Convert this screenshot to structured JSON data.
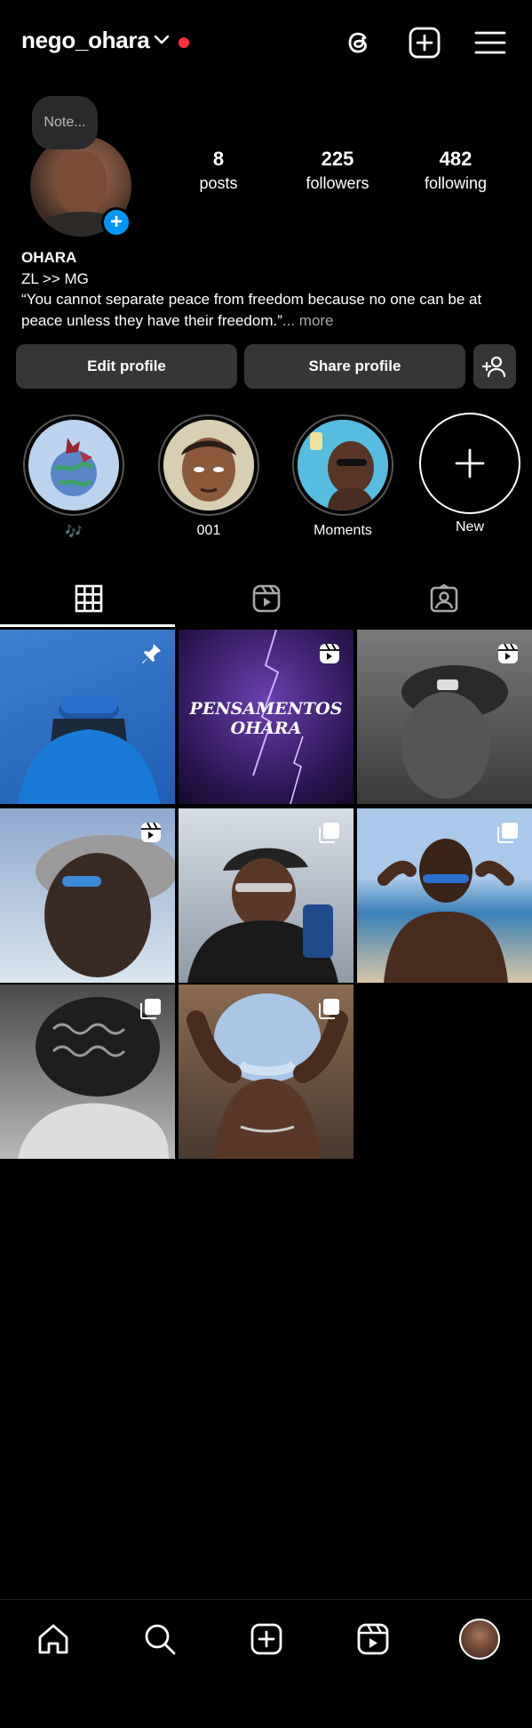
{
  "header": {
    "username": "nego_ohara"
  },
  "profile": {
    "note_placeholder": "Note...",
    "stats": [
      {
        "value": "8",
        "label": "posts"
      },
      {
        "value": "225",
        "label": "followers"
      },
      {
        "value": "482",
        "label": "following"
      }
    ],
    "bio": {
      "name": "OHARA",
      "line1": "ZL >> MG",
      "quote": "“You cannot separate peace from freedom because no one can be at peace unless they have their freedom.”",
      "more": "... more"
    }
  },
  "buttons": {
    "edit": "Edit profile",
    "share": "Share profile"
  },
  "highlights": [
    {
      "label": "🎶"
    },
    {
      "label": "001"
    },
    {
      "label": "Moments"
    },
    {
      "label": "New"
    }
  ],
  "grid": {
    "post2_text_line1": "PENSAMENTOS",
    "post2_text_line2": "OHARA"
  },
  "colors": {
    "accent": "#0095f6",
    "notification": "#ff3040",
    "button_bg": "#363636"
  }
}
